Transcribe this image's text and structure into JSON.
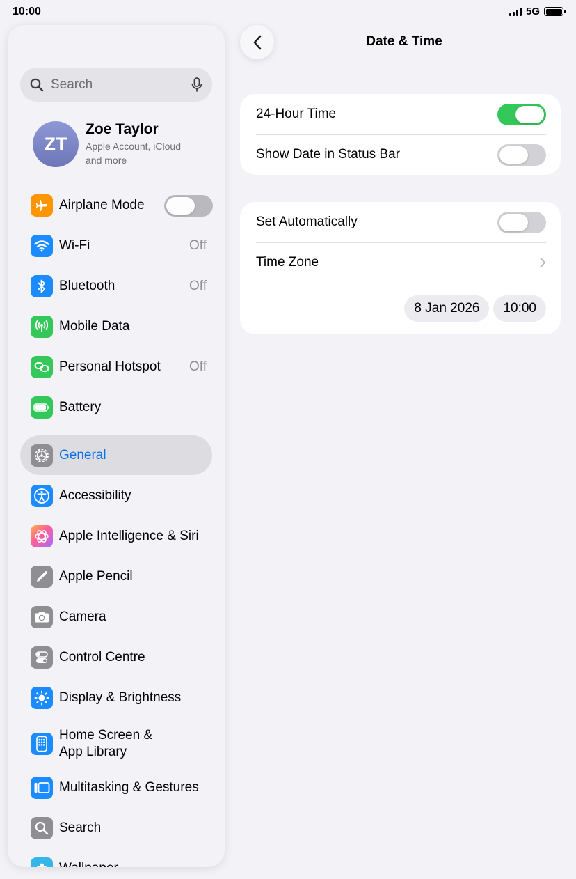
{
  "status_bar": {
    "time": "10:00",
    "network": "5G"
  },
  "sidebar": {
    "search_placeholder": "Search",
    "profile": {
      "initials": "ZT",
      "name": "Zoe Taylor",
      "subtitle": "Apple Account, iCloud and more"
    },
    "items": [
      {
        "label": "Airplane Mode",
        "icon": "airplane-icon",
        "color": "#ff9500"
      },
      {
        "label": "Wi-Fi",
        "value": "Off",
        "icon": "wifi-icon",
        "color": "#1a8cff"
      },
      {
        "label": "Bluetooth",
        "value": "Off",
        "icon": "bluetooth-icon",
        "color": "#1a8cff"
      },
      {
        "label": "Mobile Data",
        "icon": "antenna-icon",
        "color": "#34c759"
      },
      {
        "label": "Personal Hotspot",
        "value": "Off",
        "icon": "hotspot-icon",
        "color": "#34c759"
      },
      {
        "label": "Battery",
        "icon": "battery-icon",
        "color": "#34c759"
      },
      {
        "label": "General",
        "icon": "gear-icon",
        "color": "#8e8e93",
        "selected": true
      },
      {
        "label": "Accessibility",
        "icon": "accessibility-icon",
        "color": "#1a8cff"
      },
      {
        "label": "Apple Intelligence & Siri",
        "icon": "siri-icon",
        "color": "#e85dd2"
      },
      {
        "label": "Apple Pencil",
        "icon": "pencil-icon",
        "color": "#8e8e93"
      },
      {
        "label": "Camera",
        "icon": "camera-icon",
        "color": "#8e8e93"
      },
      {
        "label": "Control Centre",
        "icon": "toggles-icon",
        "color": "#8e8e93"
      },
      {
        "label": "Display & Brightness",
        "icon": "sun-icon",
        "color": "#1a8cff"
      },
      {
        "label": "Home Screen &\nApp Library",
        "label_line1": "Home Screen &",
        "label_line2": "App Library",
        "icon": "home-screen-icon",
        "color": "#1a8cff"
      },
      {
        "label": "Multitasking & Gestures",
        "icon": "multitasking-icon",
        "color": "#1a8cff"
      },
      {
        "label": "Search",
        "icon": "search-icon",
        "color": "#8e8e93"
      },
      {
        "label": "Wallpaper",
        "icon": "wallpaper-icon",
        "color": "#35b5e8"
      }
    ],
    "airplane_mode_on": false
  },
  "detail": {
    "title": "Date & Time",
    "group1": [
      {
        "label": "24-Hour Time",
        "toggle_on": true
      },
      {
        "label": "Show Date in Status Bar",
        "toggle_on": false
      }
    ],
    "group2": {
      "set_automatically": {
        "label": "Set Automatically",
        "toggle_on": false
      },
      "time_zone": {
        "label": "Time Zone"
      },
      "date": "8 Jan 2026",
      "time": "10:00"
    }
  },
  "colors": {
    "accent": "#0a72e8",
    "toggle_on": "#34c759"
  }
}
